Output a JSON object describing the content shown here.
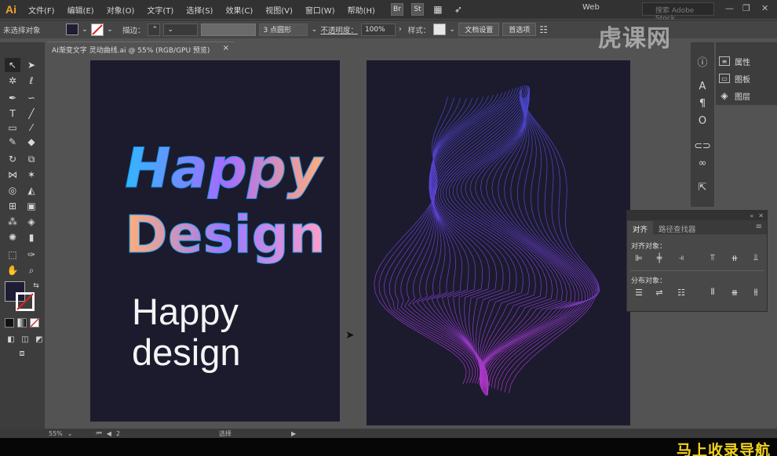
{
  "app": {
    "logo": "Ai"
  },
  "menu": [
    "文件(F)",
    "编辑(E)",
    "对象(O)",
    "文字(T)",
    "选择(S)",
    "效果(C)",
    "视图(V)",
    "窗口(W)",
    "帮助(H)"
  ],
  "menubar_icons": {
    "bridge": "Br",
    "stock": "St"
  },
  "workspace": {
    "label": "Web",
    "stock_placeholder": "搜索 Adobe Stock"
  },
  "controlbar": {
    "selection": "未选择对象",
    "stroke_label": "描边：",
    "brush": "3 点圆形",
    "opacity_label": "不透明度：",
    "opacity_value": "100%",
    "style_label": "样式：",
    "doc_settings": "文档设置",
    "preferences": "首选项",
    "fill_color": "#1e1d33"
  },
  "document": {
    "tab_title": "AI渐变文字  灵动曲线.ai @ 55% (RGB/GPU 预览)"
  },
  "artboard_left": {
    "gradient_text_line1": "Happy",
    "gradient_text_line2": "Design",
    "plain_text_line1": "Happy",
    "plain_text_line2": "design",
    "background": "#1c1b2e"
  },
  "artboard_right": {
    "background": "#1c1b2e"
  },
  "dock": {
    "panels": [
      {
        "label": "属性",
        "icon": "properties-icon"
      },
      {
        "label": "图板",
        "icon": "artboards-icon"
      },
      {
        "label": "图层",
        "icon": "layers-icon"
      }
    ]
  },
  "align_panel": {
    "tabs": [
      "对齐",
      "路径查找器"
    ],
    "align_objects_label": "对齐对象：",
    "distribute_objects_label": "分布对象："
  },
  "statusbar": {
    "zoom": "55%",
    "page": "2",
    "tool": "选择"
  },
  "watermarks": {
    "top": "虎课网",
    "bottom": "马上收录导航"
  }
}
